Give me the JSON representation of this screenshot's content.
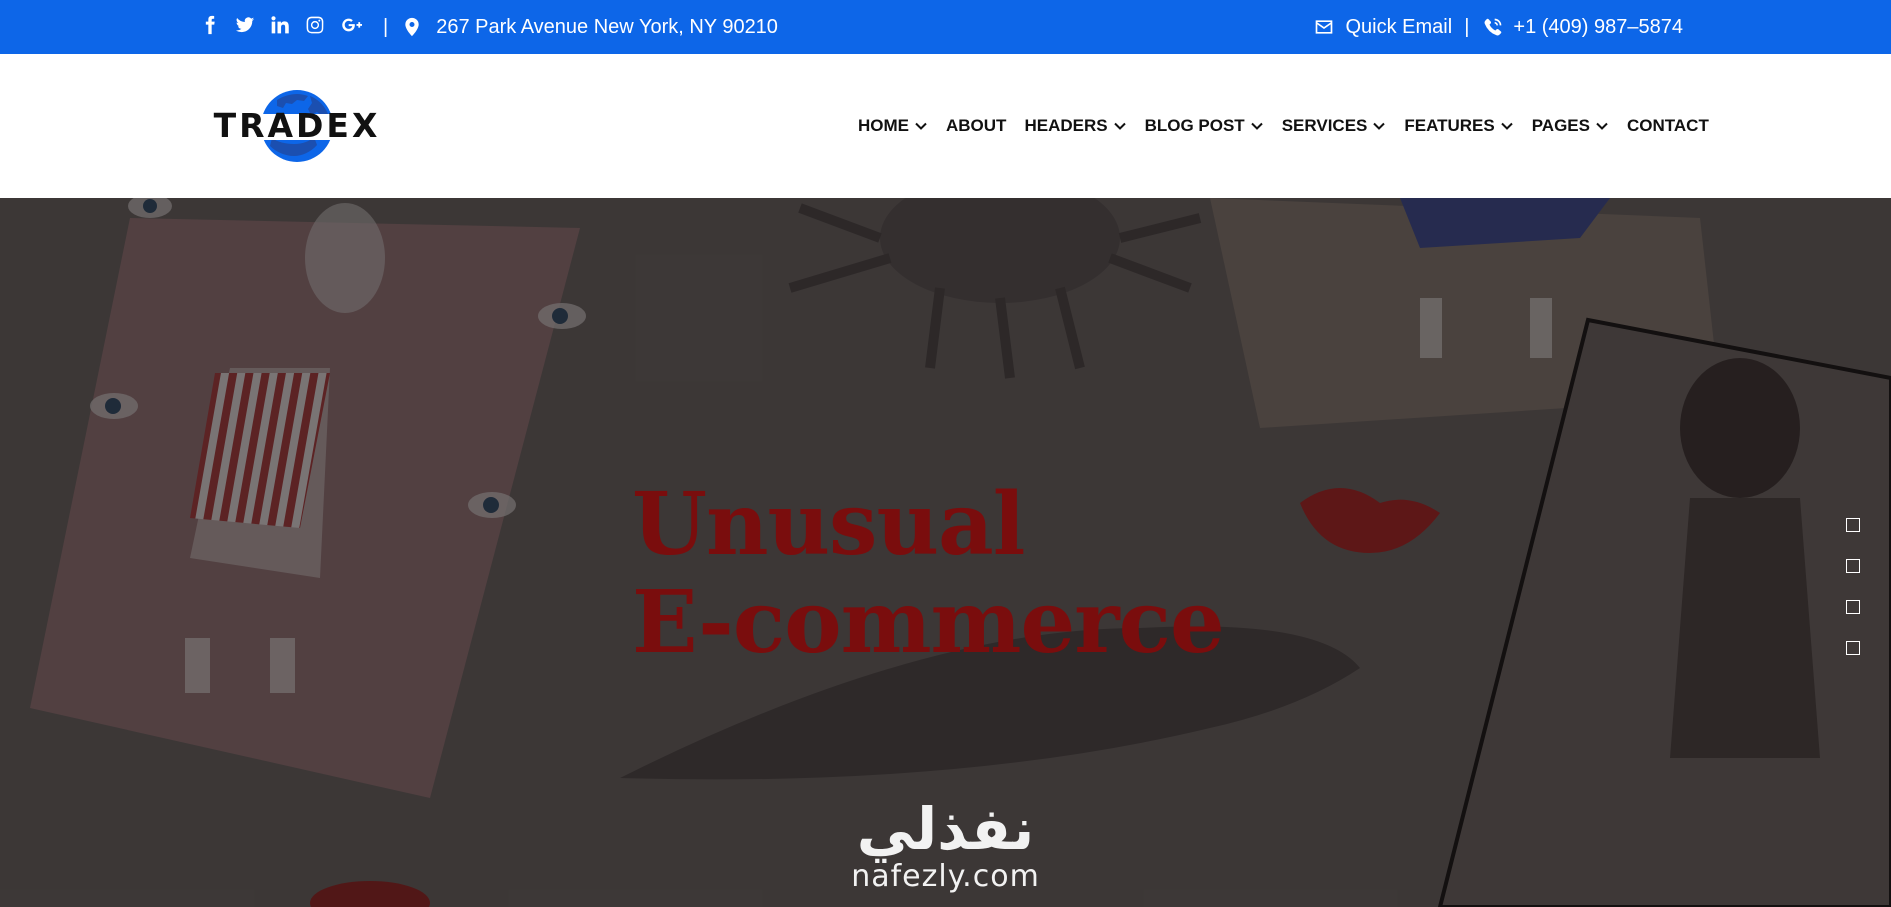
{
  "topbar": {
    "background": "#0d66e8",
    "social": [
      {
        "name": "facebook-icon"
      },
      {
        "name": "twitter-icon"
      },
      {
        "name": "linkedin-icon"
      },
      {
        "name": "instagram-icon"
      },
      {
        "name": "google-plus-icon"
      }
    ],
    "separator": "|",
    "address": "267 Park Avenue New York, NY 90210",
    "quick_email": "Quick Email",
    "phone": "+1 (409) 987–5874"
  },
  "header": {
    "logo_text": "TRADEX",
    "logo_color": "#0d66e8",
    "nav": [
      {
        "label": "HOME",
        "dropdown": true
      },
      {
        "label": "ABOUT",
        "dropdown": false
      },
      {
        "label": "HEADERS",
        "dropdown": true
      },
      {
        "label": "BLOG POST",
        "dropdown": true
      },
      {
        "label": "SERVICES",
        "dropdown": true
      },
      {
        "label": "FEATURES",
        "dropdown": true
      },
      {
        "label": "PAGES",
        "dropdown": true
      },
      {
        "label": "CONTACT",
        "dropdown": false
      }
    ]
  },
  "hero": {
    "title_line1": "Unusual",
    "title_line2": "E-commerce",
    "title_color": "#7a0d0d",
    "slides": 4
  },
  "watermark": {
    "arabic": "نفذلي",
    "latin": "nafezly.com"
  }
}
